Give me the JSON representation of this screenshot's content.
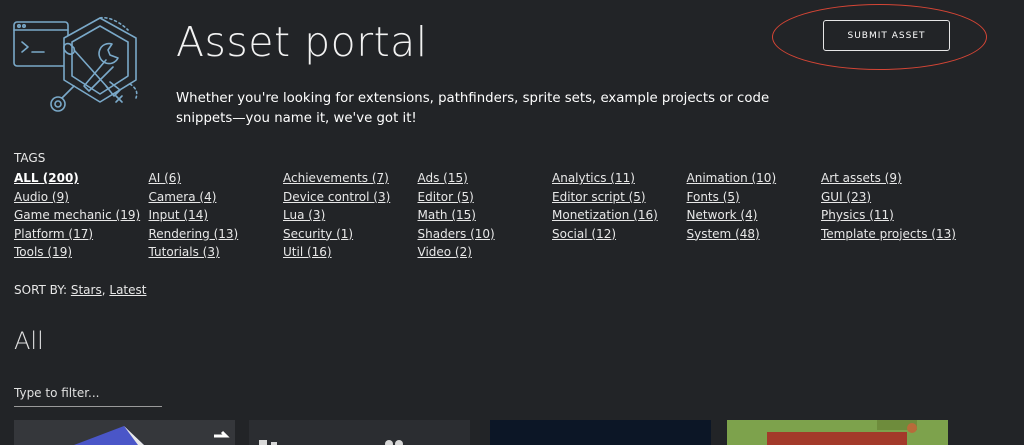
{
  "header": {
    "title": "Asset portal",
    "intro": "Whether you're looking for extensions, pathfinders, sprite sets, example projects or code snippets—you name it, we've got it!",
    "submit_label": "SUBMIT ASSET",
    "highlight_color": "#d44535"
  },
  "tags": {
    "heading": "TAGS",
    "items": [
      "ALL (200)",
      "AI (6)",
      "Achievements (7)",
      "Ads (15)",
      "Analytics (11)",
      "Animation (10)",
      "Art assets (9)",
      "Audio (9)",
      "Camera (4)",
      "Device control (3)",
      "Editor (5)",
      "Editor script (5)",
      "Fonts (5)",
      "GUI (23)",
      "Game mechanic (19)",
      "Input (14)",
      "Lua (3)",
      "Math (15)",
      "Monetization (16)",
      "Network (4)",
      "Physics (11)",
      "Platform (17)",
      "Rendering (13)",
      "Security (1)",
      "Shaders (10)",
      "Social (12)",
      "System (48)",
      "Template projects (13)",
      "Tools (19)",
      "Tutorials (3)",
      "Util (16)",
      "Video (2)"
    ]
  },
  "sort": {
    "label": "SORT BY:",
    "stars": "Stars",
    "separator": ",",
    "latest": "Latest"
  },
  "section": {
    "title": "All"
  },
  "filter": {
    "placeholder": "Type to filter..."
  },
  "colors": {
    "background": "#222427",
    "text": "#ffffff",
    "logo_stroke": "#7aa9c9"
  },
  "icons": [
    "code-window-icon",
    "paintbrush-icon",
    "wrench-icon"
  ]
}
